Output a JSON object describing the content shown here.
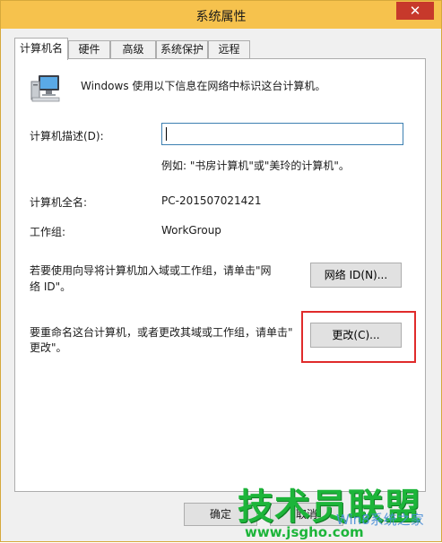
{
  "window": {
    "title": "系统属性",
    "close_glyph": "✕"
  },
  "tabs": [
    {
      "label": "计算机名",
      "active": true
    },
    {
      "label": "硬件",
      "active": false
    },
    {
      "label": "高级",
      "active": false
    },
    {
      "label": "系统保护",
      "active": false
    },
    {
      "label": "远程",
      "active": false
    }
  ],
  "panel": {
    "intro": "Windows 使用以下信息在网络中标识这台计算机。",
    "description_label": "计算机描述(D):",
    "description_value": "",
    "description_example": "例如: \"书房计算机\"或\"美玲的计算机\"。",
    "fullname_label": "计算机全名:",
    "fullname_value": "PC-201507021421",
    "workgroup_label": "工作组:",
    "workgroup_value": "WorkGroup",
    "network_id_text_line1": "若要使用向导将计算机加入域或工作组，请单击\"网",
    "network_id_text_line2": "络 ID\"。",
    "network_id_button": "网络 ID(N)...",
    "rename_text_line1": "要重命名这台计算机，或者更改其域或工作组，请单击\"",
    "rename_text_line2": "更改\"。",
    "change_button": "更改(C)..."
  },
  "footer": {
    "ok_button": "确定",
    "cancel_button": "取消"
  },
  "watermark": {
    "main": "技术员联盟",
    "url": "www.jsgho.com",
    "sub": "Win8系统之家"
  },
  "colors": {
    "titlebar": "#f6c24d",
    "close": "#c7392b",
    "highlight": "#e02b2b",
    "watermark": "#1db53a"
  }
}
